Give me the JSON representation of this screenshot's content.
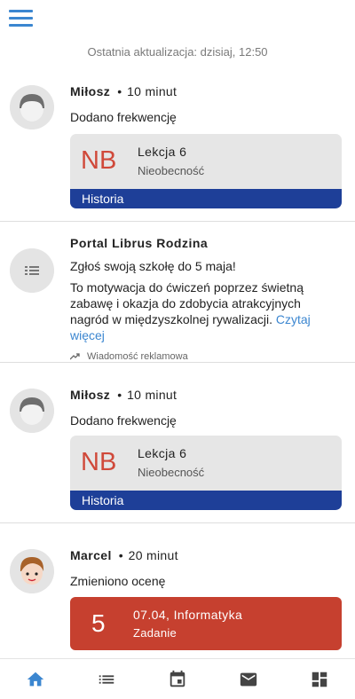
{
  "header": {
    "menu_icon": "hamburger-menu-icon"
  },
  "last_update": "Ostatnia aktualizacja: dzisiaj, 12:50",
  "feed": {
    "item1": {
      "author": "Miłosz",
      "dot": "•",
      "time": "10 minut",
      "action": "Dodano frekwencję",
      "card": {
        "code": "NB",
        "lesson": "Lekcja 6",
        "type": "Nieobecność",
        "history": "Historia"
      }
    },
    "ad": {
      "title": "Portal Librus Rodzina",
      "headline": "Zgłoś swoją szkołę do 5 maja!",
      "body": "To motywacja do ćwiczeń poprzez świetną zabawę i okazja do zdobycia atrakcyjnych nagród w międzyszkolnej rywalizacji.",
      "more": "Czytaj więcej",
      "label": "Wiadomość reklamowa"
    },
    "item2": {
      "author": "Miłosz",
      "dot": "•",
      "time": "10 minut",
      "action": "Dodano frekwencję",
      "card": {
        "code": "NB",
        "lesson": "Lekcja 6",
        "type": "Nieobecność",
        "history": "Historia"
      }
    },
    "item3": {
      "author": "Marcel",
      "dot": "•",
      "time": "20 minut",
      "action": "Zmieniono ocenę",
      "grade": {
        "value": "5",
        "title": "07.04, Informatyka",
        "subtitle": "Zadanie"
      }
    }
  },
  "bottom_nav": [
    "home-icon",
    "list-icon",
    "calendar-icon",
    "mail-icon",
    "dashboard-icon"
  ],
  "colors": {
    "accent": "#3b86d0",
    "absence": "#d0493a",
    "history_bar": "#1e3f98",
    "grade_card": "#c6402f"
  }
}
